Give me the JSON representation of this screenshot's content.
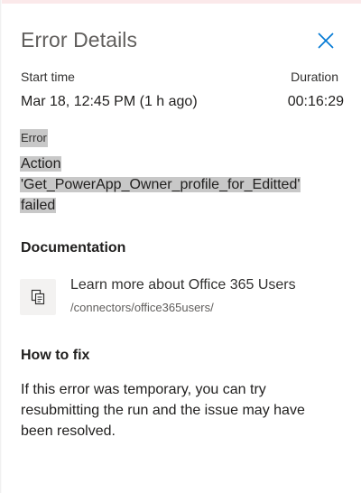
{
  "panel": {
    "title": "Error Details",
    "close_icon": "close-icon"
  },
  "run": {
    "start_time_label": "Start time",
    "start_time_value": "Mar 18, 12:45 PM (1 h ago)",
    "duration_label": "Duration",
    "duration_value": "00:16:29"
  },
  "error": {
    "label": "Error",
    "message": "Action 'Get_PowerApp_Owner_profile_for_Editted' failed"
  },
  "documentation": {
    "heading": "Documentation",
    "icon": "copy-document-icon",
    "link_title": "Learn more about Office 365 Users",
    "link_path": "/connectors/office365users/"
  },
  "how_to_fix": {
    "heading": "How to fix",
    "text": "If this error was temporary, you can try resubmitting the run and the issue may have been resolved."
  },
  "colors": {
    "accent": "#0078d4",
    "highlight": "#c8c8c8",
    "top_strip": "#fbe9ea"
  }
}
